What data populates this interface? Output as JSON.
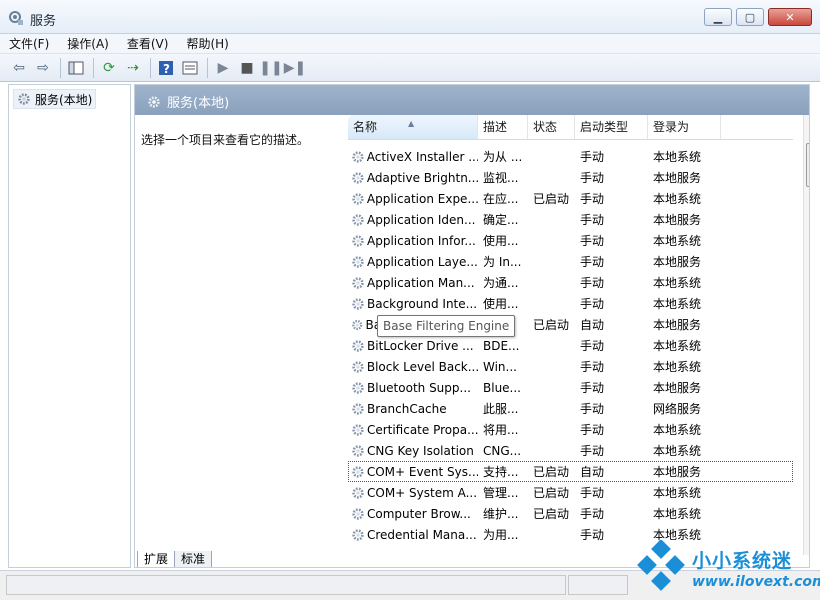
{
  "window": {
    "title": "服务",
    "buttons": [
      "minimize",
      "maximize",
      "close"
    ]
  },
  "menu": [
    "文件(F)",
    "操作(A)",
    "查看(V)",
    "帮助(H)"
  ],
  "toolbar_icons": [
    "back-icon",
    "forward-icon",
    "show-tree-icon",
    "refresh-icon",
    "export-icon",
    "help-icon",
    "properties-icon",
    "start-icon",
    "stop-icon",
    "pause-icon",
    "restart-icon"
  ],
  "tree": {
    "item": "服务(本地)"
  },
  "panel": {
    "title": "服务(本地)",
    "description": "选择一个项目来查看它的描述。"
  },
  "columns": [
    "名称",
    "描述",
    "状态",
    "启动类型",
    "登录为"
  ],
  "services": [
    {
      "name": "ActiveX Installer ...",
      "desc": "为从 ...",
      "status": "",
      "startup": "手动",
      "logon": "本地系统"
    },
    {
      "name": "Adaptive Brightn...",
      "desc": "监视...",
      "status": "",
      "startup": "手动",
      "logon": "本地服务"
    },
    {
      "name": "Application Expe...",
      "desc": "在应...",
      "status": "已启动",
      "startup": "手动",
      "logon": "本地系统"
    },
    {
      "name": "Application Iden...",
      "desc": "确定...",
      "status": "",
      "startup": "手动",
      "logon": "本地服务"
    },
    {
      "name": "Application Infor...",
      "desc": "使用...",
      "status": "",
      "startup": "手动",
      "logon": "本地系统"
    },
    {
      "name": "Application Laye...",
      "desc": "为 In...",
      "status": "",
      "startup": "手动",
      "logon": "本地服务"
    },
    {
      "name": "Application Man...",
      "desc": "为通...",
      "status": "",
      "startup": "手动",
      "logon": "本地系统"
    },
    {
      "name": "Background Inte...",
      "desc": "使用...",
      "status": "",
      "startup": "手动",
      "logon": "本地系统"
    },
    {
      "name": "Base Filtering Engine",
      "desc": "本...",
      "status": "已启动",
      "startup": "自动",
      "logon": "本地服务"
    },
    {
      "name": "BitLocker Drive ...",
      "desc": "BDE...",
      "status": "",
      "startup": "手动",
      "logon": "本地系统"
    },
    {
      "name": "Block Level Back...",
      "desc": "Win...",
      "status": "",
      "startup": "手动",
      "logon": "本地系统"
    },
    {
      "name": "Bluetooth Supp...",
      "desc": "Blue...",
      "status": "",
      "startup": "手动",
      "logon": "本地服务"
    },
    {
      "name": "BranchCache",
      "desc": "此服...",
      "status": "",
      "startup": "手动",
      "logon": "网络服务"
    },
    {
      "name": "Certificate Propa...",
      "desc": "将用...",
      "status": "",
      "startup": "手动",
      "logon": "本地系统"
    },
    {
      "name": "CNG Key Isolation",
      "desc": "CNG...",
      "status": "",
      "startup": "手动",
      "logon": "本地系统"
    },
    {
      "name": "COM+ Event Sys...",
      "desc": "支持...",
      "status": "已启动",
      "startup": "自动",
      "logon": "本地服务"
    },
    {
      "name": "COM+ System A...",
      "desc": "管理...",
      "status": "已启动",
      "startup": "手动",
      "logon": "本地系统"
    },
    {
      "name": "Computer Brow...",
      "desc": "维护...",
      "status": "已启动",
      "startup": "手动",
      "logon": "本地系统"
    },
    {
      "name": "Credential Mana...",
      "desc": "为用...",
      "status": "",
      "startup": "手动",
      "logon": "本地系统"
    }
  ],
  "tooltip": "Base Filtering Engine",
  "tabs": [
    "扩展",
    "标准"
  ],
  "watermark": {
    "text": "小小系统迷",
    "url": "www.ilovext.com"
  },
  "colors": {
    "header_band": "#8aa1bd",
    "watermark": "#1a8fd8"
  }
}
